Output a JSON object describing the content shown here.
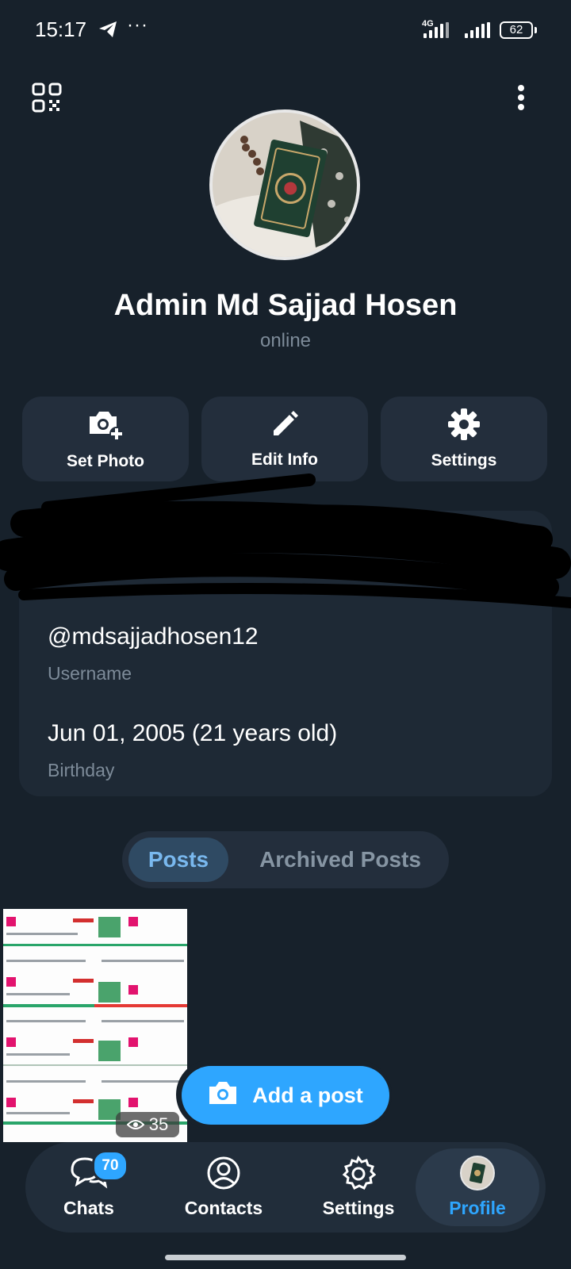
{
  "status_bar": {
    "time": "15:17",
    "more": "···",
    "network": "4G",
    "battery": "62"
  },
  "profile": {
    "name": "Admin Md Sajjad Hosen",
    "status": "online"
  },
  "actions": [
    {
      "label": "Set Photo",
      "icon": "camera-add-icon"
    },
    {
      "label": "Edit Info",
      "icon": "pencil-icon"
    },
    {
      "label": "Settings",
      "icon": "gear-icon"
    }
  ],
  "info": {
    "username_value": "@mdsajjadhosen12",
    "username_label": "Username",
    "birthday_value": "Jun 01, 2005 (21 years old)",
    "birthday_label": "Birthday"
  },
  "tabs": {
    "posts": "Posts",
    "archived": "Archived Posts"
  },
  "post": {
    "views": "35"
  },
  "add_post": {
    "label": "Add a post"
  },
  "nav": {
    "chats": "Chats",
    "chats_badge": "70",
    "contacts": "Contacts",
    "settings": "Settings",
    "profile": "Profile"
  },
  "colors": {
    "background": "#17212b",
    "card": "#1e2935",
    "accent": "#2ea6ff",
    "muted": "#7d8b99"
  }
}
